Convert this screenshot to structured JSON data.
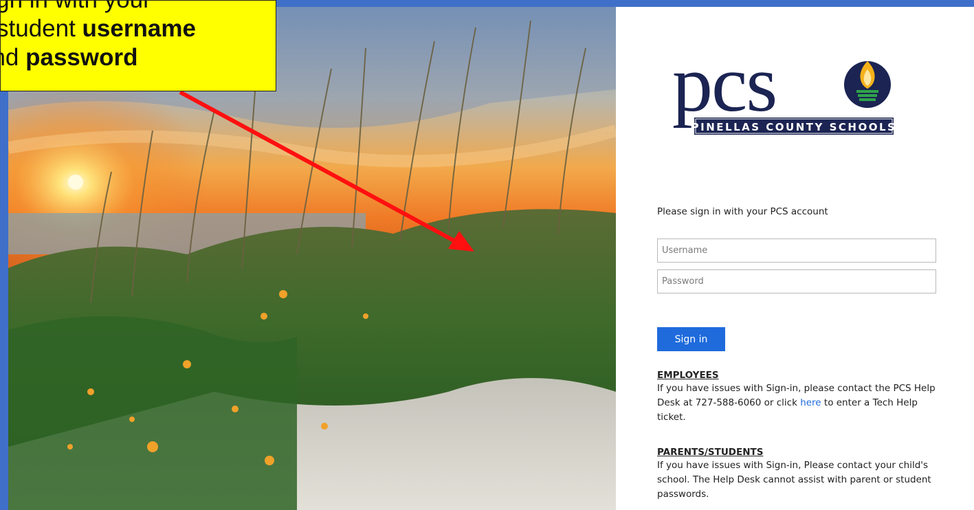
{
  "callout": {
    "line1": "Sign in with your",
    "line2_text": "student ",
    "line2_bold": "username",
    "line3_text": "and ",
    "line3_bold": "password"
  },
  "logo": {
    "wordmark": "pcs",
    "tagline": "PINELLAS COUNTY SCHOOLS",
    "colors": {
      "navy": "#1b2452",
      "gold": "#f5b21b",
      "green": "#2fa34a"
    }
  },
  "signin": {
    "prompt": "Please sign in with your PCS account",
    "username_placeholder": "Username",
    "password_placeholder": "Password",
    "button_label": "Sign in"
  },
  "employees": {
    "heading": "EMPLOYEES",
    "text_before": "If you have issues with Sign-in, please contact the PCS Help Desk at 727-588-6060 or click ",
    "link": "here",
    "text_after": " to enter a Tech Help ticket."
  },
  "parents": {
    "heading": "PARENTS/STUDENTS",
    "text": "If you have issues with Sign-in, Please contact your child's school. The Help Desk cannot assist with parent or student passwords."
  },
  "colors": {
    "frame_blue": "#3f6fc9",
    "accent": "#1f6bdc",
    "callout_bg": "#ffff00",
    "arrow": "#ff1010"
  }
}
